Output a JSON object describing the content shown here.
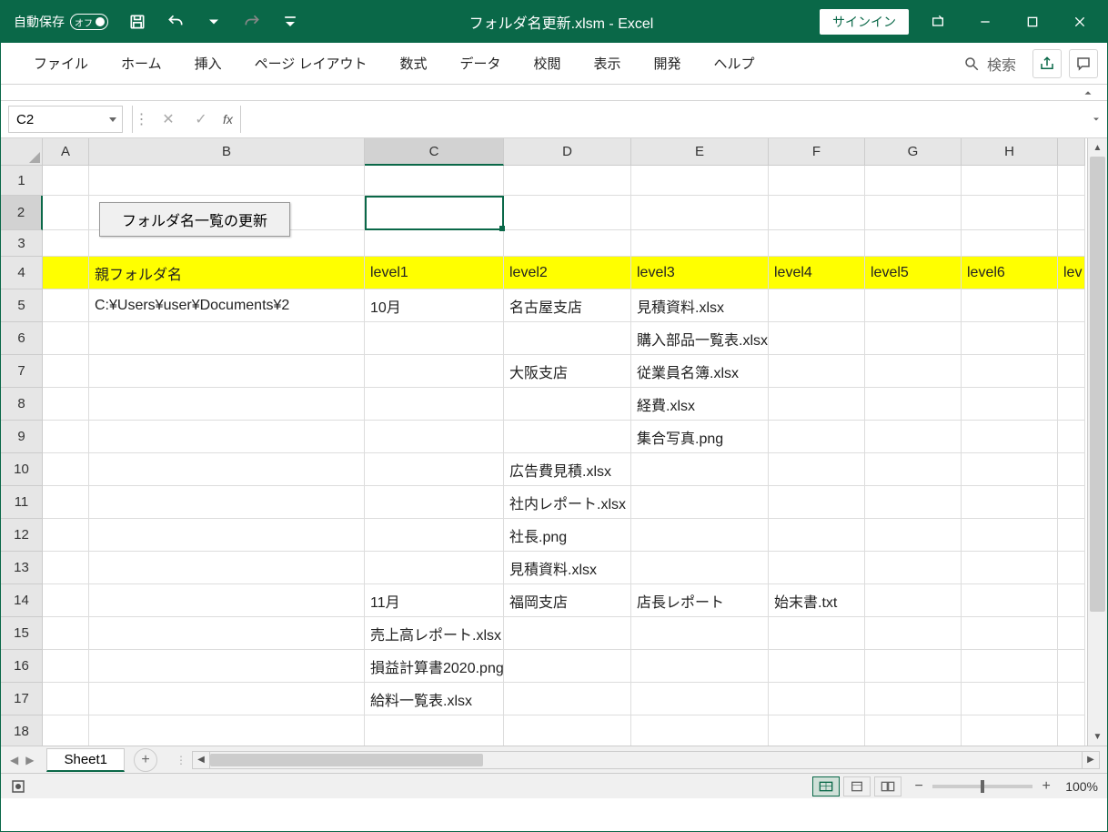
{
  "titlebar": {
    "autosave_label": "自動保存",
    "autosave_toggle": "オフ",
    "title": "フォルダ名更新.xlsm  -  Excel",
    "signin": "サインイン"
  },
  "ribbon": {
    "tabs": [
      "ファイル",
      "ホーム",
      "挿入",
      "ページ レイアウト",
      "数式",
      "データ",
      "校閲",
      "表示",
      "開発",
      "ヘルプ"
    ],
    "search_placeholder": "検索"
  },
  "formula_bar": {
    "name_box": "C2",
    "fx": "fx",
    "formula": ""
  },
  "columns": [
    "A",
    "B",
    "C",
    "D",
    "E",
    "F",
    "G",
    "H"
  ],
  "rows": [
    "1",
    "2",
    "3",
    "4",
    "5",
    "6",
    "7",
    "8",
    "9",
    "10",
    "11",
    "12",
    "13",
    "14",
    "15",
    "16",
    "17",
    "18"
  ],
  "button_on_sheet": "フォルダ名一覧の更新",
  "header_row": {
    "B": "親フォルダ名",
    "C": "level1",
    "D": "level2",
    "E": "level3",
    "F": "level4",
    "G": "level5",
    "H": "level6",
    "I": "lev"
  },
  "data_rows": [
    {
      "B": "C:¥Users¥user¥Documents¥2",
      "C": "10月",
      "D": "名古屋支店",
      "E": "見積資料.xlsx"
    },
    {
      "E": "購入部品一覧表.xlsx"
    },
    {
      "D": "大阪支店",
      "E": "従業員名簿.xlsx"
    },
    {
      "E": "経費.xlsx"
    },
    {
      "E": "集合写真.png"
    },
    {
      "D": "広告費見積.xlsx"
    },
    {
      "D": "社内レポート.xlsx"
    },
    {
      "D": "社長.png"
    },
    {
      "D": "見積資料.xlsx"
    },
    {
      "C": "11月",
      "D": "福岡支店",
      "E": "店長レポート",
      "F": "始末書.txt"
    },
    {
      "C": "売上高レポート.xlsx"
    },
    {
      "C": "損益計算書2020.png"
    },
    {
      "C": "給料一覧表.xlsx"
    },
    {}
  ],
  "active_cell": "C2",
  "tabs": {
    "sheet1": "Sheet1"
  },
  "status": {
    "zoom": "100%"
  }
}
